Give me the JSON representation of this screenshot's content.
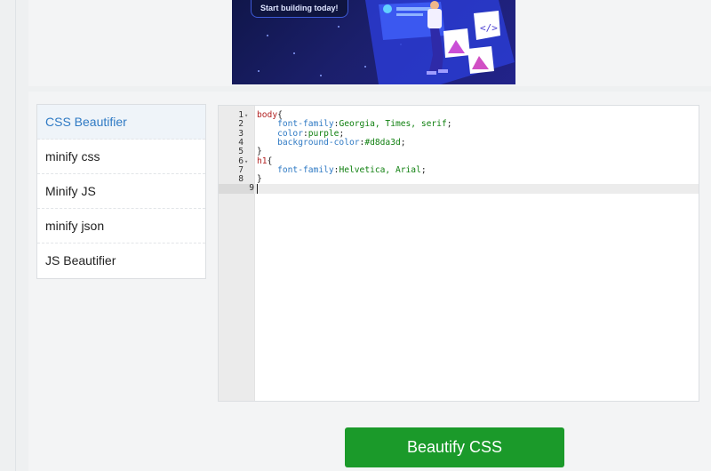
{
  "banner": {
    "tagline": "Start building today!"
  },
  "sidebar": {
    "items": [
      {
        "label": "CSS Beautifier",
        "active": true
      },
      {
        "label": "minify css",
        "active": false
      },
      {
        "label": "Minify JS",
        "active": false
      },
      {
        "label": "minify json",
        "active": false
      },
      {
        "label": "JS Beautifier",
        "active": false
      }
    ]
  },
  "editor": {
    "lines": [
      {
        "num": "1",
        "fold": true,
        "sel": "body",
        "punct": "{"
      },
      {
        "num": "2",
        "prop": "font-family",
        "val": "Georgia, Times, serif"
      },
      {
        "num": "3",
        "prop": "color",
        "val": "purple"
      },
      {
        "num": "4",
        "prop": "background-color",
        "val": "#d8da3d"
      },
      {
        "num": "5",
        "punct": "}"
      },
      {
        "num": "6",
        "fold": true,
        "sel": "h1",
        "punct": "{"
      },
      {
        "num": "7",
        "prop": "font-family",
        "val": "Helvetica, Arial"
      },
      {
        "num": "8",
        "punct": "}"
      },
      {
        "num": "9",
        "active": true
      }
    ]
  },
  "actions": {
    "beautify_label": "Beautify CSS"
  },
  "colors": {
    "accent": "#1b9a2a",
    "link": "#2f7ac4",
    "selector": "#b22222",
    "value": "#108010"
  }
}
